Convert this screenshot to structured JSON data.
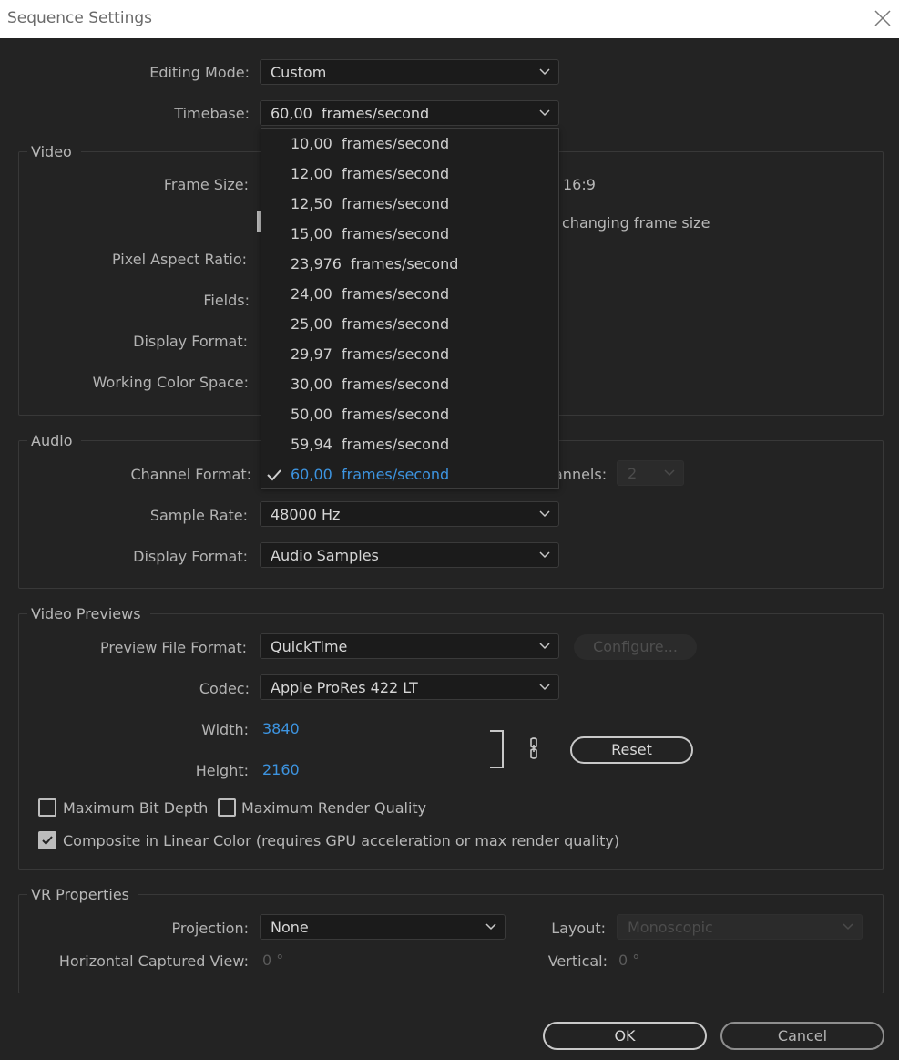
{
  "window": {
    "title": "Sequence Settings",
    "close_glyph": "╳"
  },
  "editing_mode": {
    "label": "Editing Mode:",
    "value": "Custom"
  },
  "timebase": {
    "label": "Timebase:",
    "value": "60,00  frames/second",
    "options": [
      "10,00  frames/second",
      "12,00  frames/second",
      "12,50  frames/second",
      "15,00  frames/second",
      "23,976  frames/second",
      "24,00  frames/second",
      "25,00  frames/second",
      "29,97  frames/second",
      "30,00  frames/second",
      "50,00  frames/second",
      "59,94  frames/second",
      "60,00  frames/second"
    ],
    "selected_index": 11
  },
  "video": {
    "title": "Video",
    "frame_size_label": "Frame Size:",
    "aspect_text": "16:9",
    "scale_text": "changing frame size",
    "pixel_aspect_label": "Pixel Aspect Ratio:",
    "fields_label": "Fields:",
    "display_format_label": "Display Format:",
    "color_space_label": "Working Color Space:"
  },
  "audio": {
    "title": "Audio",
    "channel_format_label": "Channel Format:",
    "channels_label": "annels:",
    "channels_value": "2",
    "sample_rate_label": "Sample Rate:",
    "sample_rate_value": "48000 Hz",
    "display_format_label": "Display Format:",
    "display_format_value": "Audio Samples"
  },
  "previews": {
    "title": "Video Previews",
    "file_format_label": "Preview File Format:",
    "file_format_value": "QuickTime",
    "configure_label": "Configure...",
    "codec_label": "Codec:",
    "codec_value": "Apple ProRes 422 LT",
    "width_label": "Width:",
    "width_value": "3840",
    "height_label": "Height:",
    "height_value": "2160",
    "reset_label": "Reset",
    "max_bit_depth_label": "Maximum Bit Depth",
    "max_bit_depth_checked": false,
    "max_render_quality_label": "Maximum Render Quality",
    "max_render_quality_checked": false,
    "linear_color_label": "Composite in Linear Color (requires GPU acceleration or max render quality)",
    "linear_color_checked": true
  },
  "vr": {
    "title": "VR Properties",
    "projection_label": "Projection:",
    "projection_value": "None",
    "layout_label": "Layout:",
    "layout_value": "Monoscopic",
    "hview_label": "Horizontal Captured View:",
    "hview_value": "0 °",
    "vertical_label": "Vertical:",
    "vertical_value": "0 °"
  },
  "buttons": {
    "ok": "OK",
    "cancel": "Cancel"
  },
  "colors": {
    "accent": "#3d94e0",
    "background": "#232323",
    "field": "#1b1b1b"
  }
}
